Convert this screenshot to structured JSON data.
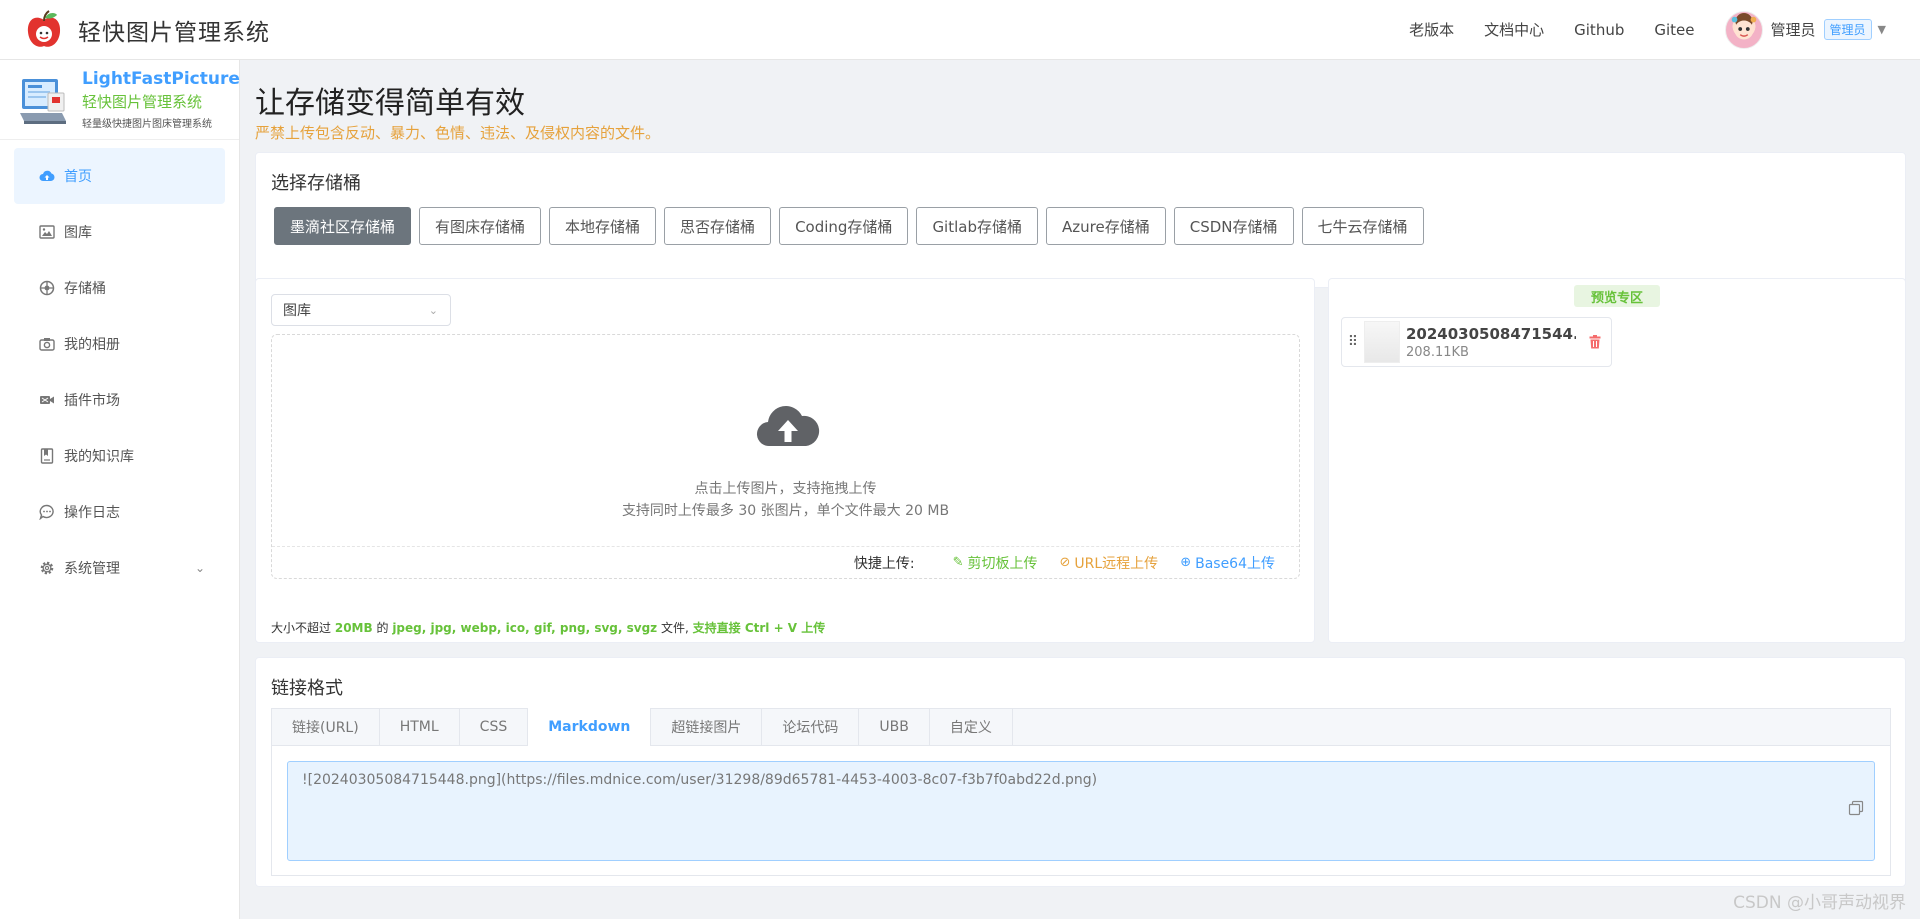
{
  "header": {
    "app_title": "轻快图片管理系统",
    "nav": [
      "老版本",
      "文档中心",
      "Github",
      "Gitee"
    ],
    "user_name": "管理员",
    "role": "管理员"
  },
  "sidebar": {
    "brand_en": "LightFastPicture",
    "brand_cn": "轻快图片管理系统",
    "brand_sub": "轻量级快捷图片图床管理系统",
    "items": [
      {
        "label": "首页",
        "icon": "cloud-upload-icon",
        "active": true
      },
      {
        "label": "图库",
        "icon": "image-icon"
      },
      {
        "label": "存储桶",
        "icon": "bucket-icon"
      },
      {
        "label": "我的相册",
        "icon": "camera-icon"
      },
      {
        "label": "插件市场",
        "icon": "plugin-icon"
      },
      {
        "label": "我的知识库",
        "icon": "book-icon"
      },
      {
        "label": "操作日志",
        "icon": "chat-icon"
      },
      {
        "label": "系统管理",
        "icon": "gear-icon",
        "expandable": true
      }
    ]
  },
  "page": {
    "title": "让存储变得简单有效",
    "warning": "严禁上传包含反动、暴力、色情、违法、及侵权内容的文件。"
  },
  "buckets": {
    "title": "选择存储桶",
    "items": [
      "墨滴社区存储桶",
      "有图床存储桶",
      "本地存储桶",
      "思否存储桶",
      "Coding存储桶",
      "Gitlab存储桶",
      "Azure存储桶",
      "CSDN存储桶",
      "七牛云存储桶"
    ],
    "active_index": 0
  },
  "upload": {
    "select_value": "图库",
    "hint1": "点击上传图片，支持拖拽上传",
    "hint2": "支持同时上传最多 30 张图片，单个文件最大 20 MB",
    "quick_label": "快捷上传:",
    "quick_clipboard": "剪切板上传",
    "quick_url": "URL远程上传",
    "quick_base64": "Base64上传",
    "limit_prefix": "大小不超过",
    "limit_size": "20MB",
    "limit_mid": "的",
    "limit_formats": "jpeg, jpg, webp, ico, gif, png, svg, svgz",
    "limit_files": "文件,",
    "limit_paste": "支持直接 Ctrl + V 上传"
  },
  "preview": {
    "badge": "预览专区",
    "file_name": "2024030508471544...",
    "file_size": "208.11KB"
  },
  "links": {
    "title": "链接格式",
    "tabs": [
      "链接(URL)",
      "HTML",
      "CSS",
      "Markdown",
      "超链接图片",
      "论坛代码",
      "UBB",
      "自定义"
    ],
    "active_index": 3,
    "code": "![20240305084715448.png](https://files.mdnice.com/user/31298/89d65781-4453-4003-8c07-f3b7f0abd22d.png)"
  },
  "watermark": "CSDN @小哥声动视界",
  "colors": {
    "primary": "#409eff",
    "success": "#67c23a",
    "warning": "#e6a23c",
    "danger": "#f56c6c",
    "button_active": "#6c757d"
  }
}
